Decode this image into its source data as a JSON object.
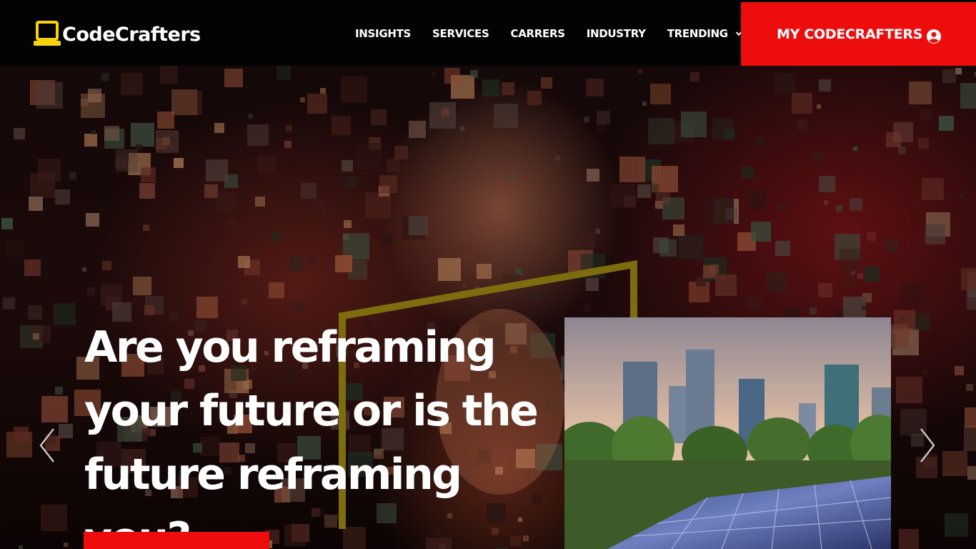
{
  "brand": {
    "name": "CodeCrafters",
    "accent_color": "#ed0d0d",
    "logo_color": "#f6d20f",
    "logo_icon": "laptop-icon"
  },
  "nav": {
    "items": [
      {
        "label": "INSIGHTS"
      },
      {
        "label": "SERVICES"
      },
      {
        "label": "CARRERS"
      },
      {
        "label": "INDUSTRY"
      },
      {
        "label": "TRENDING",
        "icon": "chevron-down-icon"
      }
    ],
    "account_button": {
      "label": "MY CODECRAFTERS",
      "icon": "user-circle-icon"
    }
  },
  "hero": {
    "headline_lines": [
      "Are you reframing",
      "your future or is the",
      "future reframing you?"
    ],
    "photo_alt": "city-solar-panels-image",
    "carousel": {
      "prev_icon": "chevron-left-icon",
      "next_icon": "chevron-right-icon"
    },
    "frame_color": "#8a7a10"
  }
}
